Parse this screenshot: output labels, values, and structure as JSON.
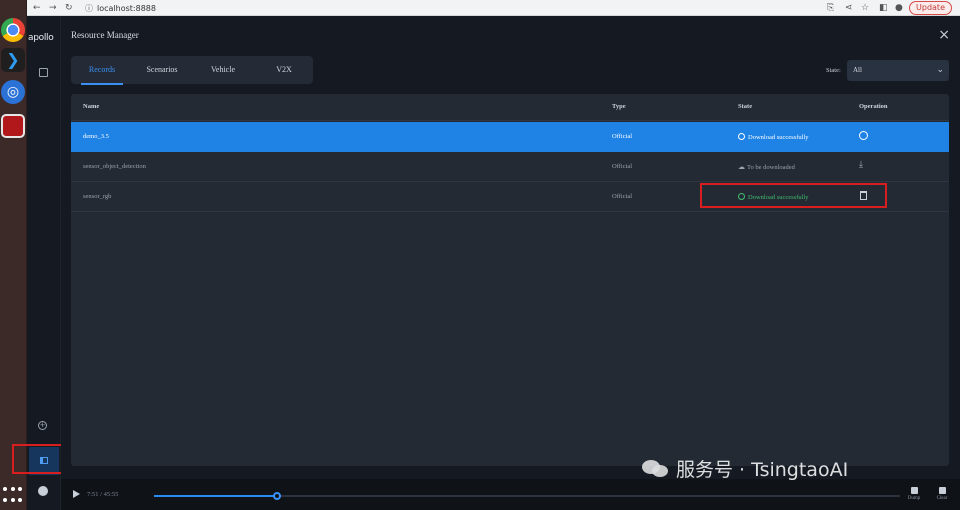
{
  "browser": {
    "url": "localhost:8888",
    "update_label": "Update"
  },
  "app": {
    "logo_text": "apollo"
  },
  "modal": {
    "title": "Resource Manager",
    "close_glyph": "×",
    "tabs": [
      {
        "label": "Records",
        "active": true
      },
      {
        "label": "Scenarios",
        "active": false
      },
      {
        "label": "Vehicle",
        "active": false
      },
      {
        "label": "V2X",
        "active": false
      }
    ],
    "state_filter": {
      "label": "State:",
      "value": "All"
    },
    "table": {
      "columns": [
        "Name",
        "Type",
        "State",
        "Operation"
      ],
      "rows": [
        {
          "name": "demo_3.5",
          "type": "Official",
          "state": "Download successfully",
          "state_icon": "check-circle-icon",
          "operation_icon": "check-circle-icon",
          "selected": true
        },
        {
          "name": "sensor_object_detection",
          "type": "Official",
          "state": "To be downloaded",
          "state_icon": "cloud-download-icon",
          "operation_icon": "download-icon",
          "selected": false
        },
        {
          "name": "sensor_rgb",
          "type": "Official",
          "state": "Download successfully",
          "state_icon": "check-circle-icon",
          "operation_icon": "trash-icon",
          "selected": false
        }
      ]
    }
  },
  "playback": {
    "time": "7:51 / 45:55",
    "progress_fraction": 0.165,
    "dump_label": "Dump",
    "clear_label": "Clear"
  },
  "watermark": {
    "text": "服务号 · TsingtaoAI"
  },
  "colors": {
    "accent": "#1f83e6",
    "success": "#3fbf6f",
    "highlight_box": "#d81e1e"
  }
}
